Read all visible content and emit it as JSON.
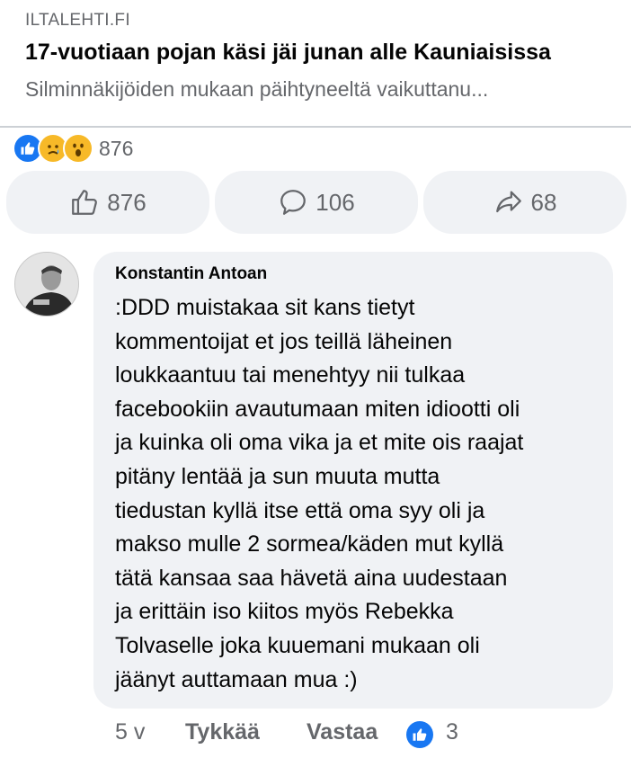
{
  "link_preview": {
    "source": "ILTALEHTI.FI",
    "headline": "17-vuotiaan pojan käsi jäi junan alle Kauniaisissa",
    "description": "Silminnäkijöiden mukaan päihtyneeltä vaikuttanu..."
  },
  "reactions": {
    "icons": [
      "like-icon",
      "sad-icon",
      "wow-icon"
    ],
    "count": "876"
  },
  "actions": {
    "like_count": "876",
    "comment_count": "106",
    "share_count": "68"
  },
  "comment": {
    "author": "Konstantin Antoan",
    "text": ":DDD muistakaa sit kans tietyt\nkommentoijat et jos teillä läheinen\nloukkaantuu tai menehtyy nii tulkaa\nfacebookiin avautumaan miten idiootti oli\nja kuinka oli oma vika ja et mite ois raajat\npitäny lentää ja sun muuta mutta\ntiedustan kyllä itse että oma syy oli ja\nmakso mulle 2 sormea/käden mut kyllä\ntätä kansaa saa hävetä   aina uudestaan\nja erittäin iso kiitos myös Rebekka\nTolvaselle joka kuuemani mukaan oli\njäänyt auttamaan mua :)",
    "time": "5 v",
    "like_label": "Tykkää",
    "reply_label": "Vastaa",
    "reaction_count": "3"
  },
  "colors": {
    "facebook_blue": "#1877f2",
    "emoji_yellow": "#f7b928",
    "secondary_text": "#65676b",
    "bubble_bg": "#f0f2f5"
  }
}
